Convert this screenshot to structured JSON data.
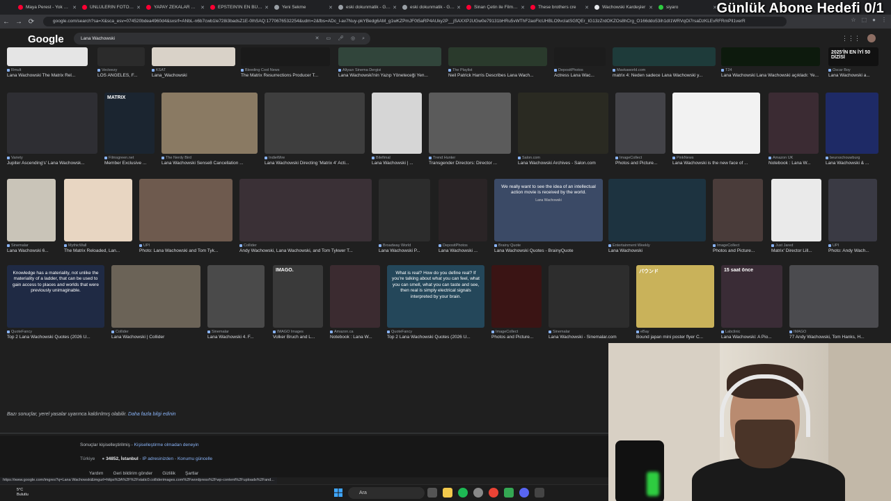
{
  "overlay": {
    "title": "Günlük Abone Hedefi 0/1"
  },
  "browser": {
    "tabs": [
      {
        "title": "Maya Perest - Yok Bas",
        "color": "#ff0033"
      },
      {
        "title": "ÜNLÜLERİN FOTOĞRA",
        "color": "#ff0033"
      },
      {
        "title": "YAPAY ZEKALAR KEND",
        "color": "#ff0033"
      },
      {
        "title": "EPSTEIN'IN EN BÜYÜK",
        "color": "#ff0033"
      },
      {
        "title": "Yeni Sekme",
        "color": "#9aa0a6"
      },
      {
        "title": "eski dokunmatik - Goo",
        "color": "#9aa0a6"
      },
      {
        "title": "eski dokunmatik - Goo",
        "color": "#9aa0a6"
      },
      {
        "title": "Sinan Çetin ile Film Gi",
        "color": "#ff0033"
      },
      {
        "title": "These brothers cre",
        "color": "#ff0033"
      },
      {
        "title": "Wachowski Kardeşler",
        "color": "#e8eaed"
      },
      {
        "title": "siyaro",
        "color": "#2ecc40"
      }
    ],
    "url": "google.com/search?sa=X&sca_esv=074520bdea4960d4&sxsrf=ANbL-n6b7cwb1le728i3badsZ1E-0lhSAQ:1770676532254&udm=2&fbs=ADc_l-av7Nuy-pkYBedg6AM_g1wKZPmJF0t5aRP4AUky2P__jSAXXPJUGw0e79131bHRu5vWThF2aoFIcUHBLO9vcIatSGfQEr_IG13zZrdOKZOs8hCrg_O166ddo53ih1dI1WRVqOi7rsaDzKLEvRFRmPll1verR"
  },
  "google": {
    "logo": "Google",
    "query": "Lana Wachowski",
    "icons": [
      "close-icon",
      "image-search-icon",
      "mic-icon",
      "lens-icon",
      "search-icon"
    ]
  },
  "rows": [
    [
      {
        "src": "Rmult",
        "cap": "Lana Wachowski The Matrix Rel...",
        "bg": "#e5e5e5"
      },
      {
        "src": "Vecteezy",
        "cap": "LOS ANGELES, F...",
        "bg": "#2b2b2b"
      },
      {
        "src": "KSAT",
        "cap": "Lana_Wachowski",
        "bg": "#d9d2c8"
      },
      {
        "src": "Bleeding Cool News",
        "cap": "The Matrix Resurrections Producer T...",
        "bg": "#1a1a1a"
      },
      {
        "src": "Altyazı Sinema Dergisi",
        "cap": "Lana Wachowski'nin Yazıp Yöneteceği Yen...",
        "bg": "#31453b"
      },
      {
        "src": "The Playlist",
        "cap": "Neil Patrick Harris Describes Lana Wach...",
        "bg": "#2a3a2c"
      },
      {
        "src": "DepositPhotos",
        "cap": "Actress Lana Wac...",
        "bg": "#1c1c1c"
      },
      {
        "src": "Mavkaworld.com",
        "cap": "matrix 4: Neden sadece Lana Wachowski y...",
        "bg": "#1e3b3a"
      },
      {
        "src": "T24",
        "cap": "Lana Wachowski Lana Wachowski açıkladı: Ye...",
        "bg": "#0d1a0d"
      },
      {
        "src": "Oscar Boy",
        "cap": "Lana Wachowski a...",
        "bg": "#111",
        "text": "2025'İN EN İYİ 50 DİZİSİ"
      }
    ],
    [
      {
        "src": "Variety",
        "cap": "Jupiter Ascending's' Lana Wachowsk...",
        "bg": "#2e2e33"
      },
      {
        "src": "Filmsgreen.net",
        "cap": "Member Exclusive ...",
        "bg": "#1b2530",
        "text": "MATRIX"
      },
      {
        "src": "The Nerdy Bird",
        "cap": "Lana Wachowski Sense8 Cancellation ...",
        "bg": "#8a7a63"
      },
      {
        "src": "IndieWire",
        "cap": "Lana Wachowski Directing 'Matrix 4' Acti...",
        "bg": "#3e3e3e"
      },
      {
        "src": "Bilefimal",
        "cap": "Lana Wachowski | ...",
        "bg": "#d6d6d6"
      },
      {
        "src": "Trend Hunter",
        "cap": "Transgender Directors: Director ...",
        "bg": "#5b5b5b"
      },
      {
        "src": "Salon.com",
        "cap": "Lana Wachowski Archives - Salon.com",
        "bg": "#2a2a22"
      },
      {
        "src": "ImageCollect",
        "cap": "Photos and Picture...",
        "bg": "#434348"
      },
      {
        "src": "PinkNews",
        "cap": "Lana Wachowski is the new face of ...",
        "bg": "#f2f2f2"
      },
      {
        "src": "Amazon UK",
        "cap": "Notebook : Lana W...",
        "bg": "#3b2b33"
      },
      {
        "src": "beursschouwburg",
        "cap": "Lana Wachowski & ...",
        "bg": "#1e2a66"
      }
    ],
    [
      {
        "src": "Sinemalar",
        "cap": "Lana Wachowski 6...",
        "bg": "#c9c4b8"
      },
      {
        "src": "MythicWall",
        "cap": "The Matrix Reloaded, Lan...",
        "bg": "#e8d6c2"
      },
      {
        "src": "UPI",
        "cap": "Photo: Lana Wachowski and Tom Tyk...",
        "bg": "#6e5a4e"
      },
      {
        "src": "Collider",
        "cap": "Andy Wachowski, Lana Wachowski, and Tom Tykwer T...",
        "bg": "#3a3036"
      },
      {
        "src": "Broadway World",
        "cap": "Lana Wachowski P...",
        "bg": "#2c2c2c"
      },
      {
        "src": "DepositPhotos",
        "cap": "Lana Wachowski ...",
        "bg": "#2a2426"
      },
      {
        "src": "Brainy Quote",
        "cap": "Lana Wachowski Quotes - BrainyQuote",
        "bg": "#3b4a66",
        "text": "We really want to see the idea of an intellectual action movie is received by the world.",
        "sub": "Lana Wachowski"
      },
      {
        "src": "Entertainment Weekly",
        "cap": "Lana Wachowski",
        "bg": "#1d3340"
      },
      {
        "src": "ImageCollect",
        "cap": "Photos and Picture...",
        "bg": "#4a3c3a"
      },
      {
        "src": "Just Jared",
        "cap": "Matrix' Director Lill...",
        "bg": "#eaeaea"
      },
      {
        "src": "UPI",
        "cap": "Photo: Andy Wach...",
        "bg": "#3a3a44"
      }
    ],
    [
      {
        "src": "QuoteFancy",
        "cap": "Top 2 Lana Wachowski Quotes (2026 U...",
        "bg": "#1f2a44",
        "text": "Knowledge has a materiality, not unlike the materiality of a ladder, that can be used to gain access to places and worlds that were previously unimaginable."
      },
      {
        "src": "Collider",
        "cap": "Lana Wachowski | Collider",
        "bg": "#6b6357"
      },
      {
        "src": "Sinemalar",
        "cap": "Lana Wachowski 4. F...",
        "bg": "#4a4a4a"
      },
      {
        "src": "IMAGO Images",
        "cap": "Volker Bruch and L...",
        "bg": "#3a3a3a",
        "text": "IMAGO."
      },
      {
        "src": "Amazon.ca",
        "cap": "Notebook : Lana W...",
        "bg": "#3b2b30"
      },
      {
        "src": "QuoteFancy",
        "cap": "Top 2 Lana Wachowski Quotes (2026 U...",
        "bg": "#24475a",
        "text": "What is real? How do you define real? If you're talking about what you can feel, what you can smell, what you can taste and see, then real is simply electrical signals interpreted by your brain."
      },
      {
        "src": "ImageCollect",
        "cap": "Photos and Picture...",
        "bg": "#3a1414"
      },
      {
        "src": "Sinemalar",
        "cap": "Lana Wachowski - Sinemalar.com",
        "bg": "#2d2d2d"
      },
      {
        "src": "eBay",
        "cap": "Bound japan mini poster flyer C...",
        "bg": "#c9b25a",
        "text": "バウンド"
      },
      {
        "src": "Labclinic",
        "cap": "Lana Wachowski: A Pio...",
        "bg": "#3a2c36",
        "text": "15 saat önce"
      },
      {
        "src": "IMAGO",
        "cap": "77 Andy Wachowski, Tom Hanks, H...",
        "bg": "#4b4b4f"
      }
    ]
  ],
  "notice": {
    "text": "Bazı sonuçlar, yerel yasalar uyarınca kaldırılmış olabilir.",
    "link": "Daha fazla bilgi edinin"
  },
  "footer": {
    "personal": "Sonuçlar kişiselleştirilmiş -",
    "personal_link": "Kişiselleştirme olmadan deneyin",
    "country": "Türkiye",
    "location": "34852, İstanbul",
    "loc_sep": "- ",
    "ip_link": "IP adresinizden",
    "update_link": "Konumu güncelle",
    "links": [
      "Yardım",
      "Geri bildirim gönder",
      "Gizlilik",
      "Şartlar"
    ]
  },
  "status_url": "https://www.google.com/imgres?q=Lana Wachowski&imgurl=https%3A%2F%2Fstatic0.colliderimages.com%2Fwordpress%2Fwp-content%2Fuploads%2Fand...",
  "taskbar": {
    "temp": "5°C",
    "weather": "Bulutlu",
    "search": "Ara"
  }
}
